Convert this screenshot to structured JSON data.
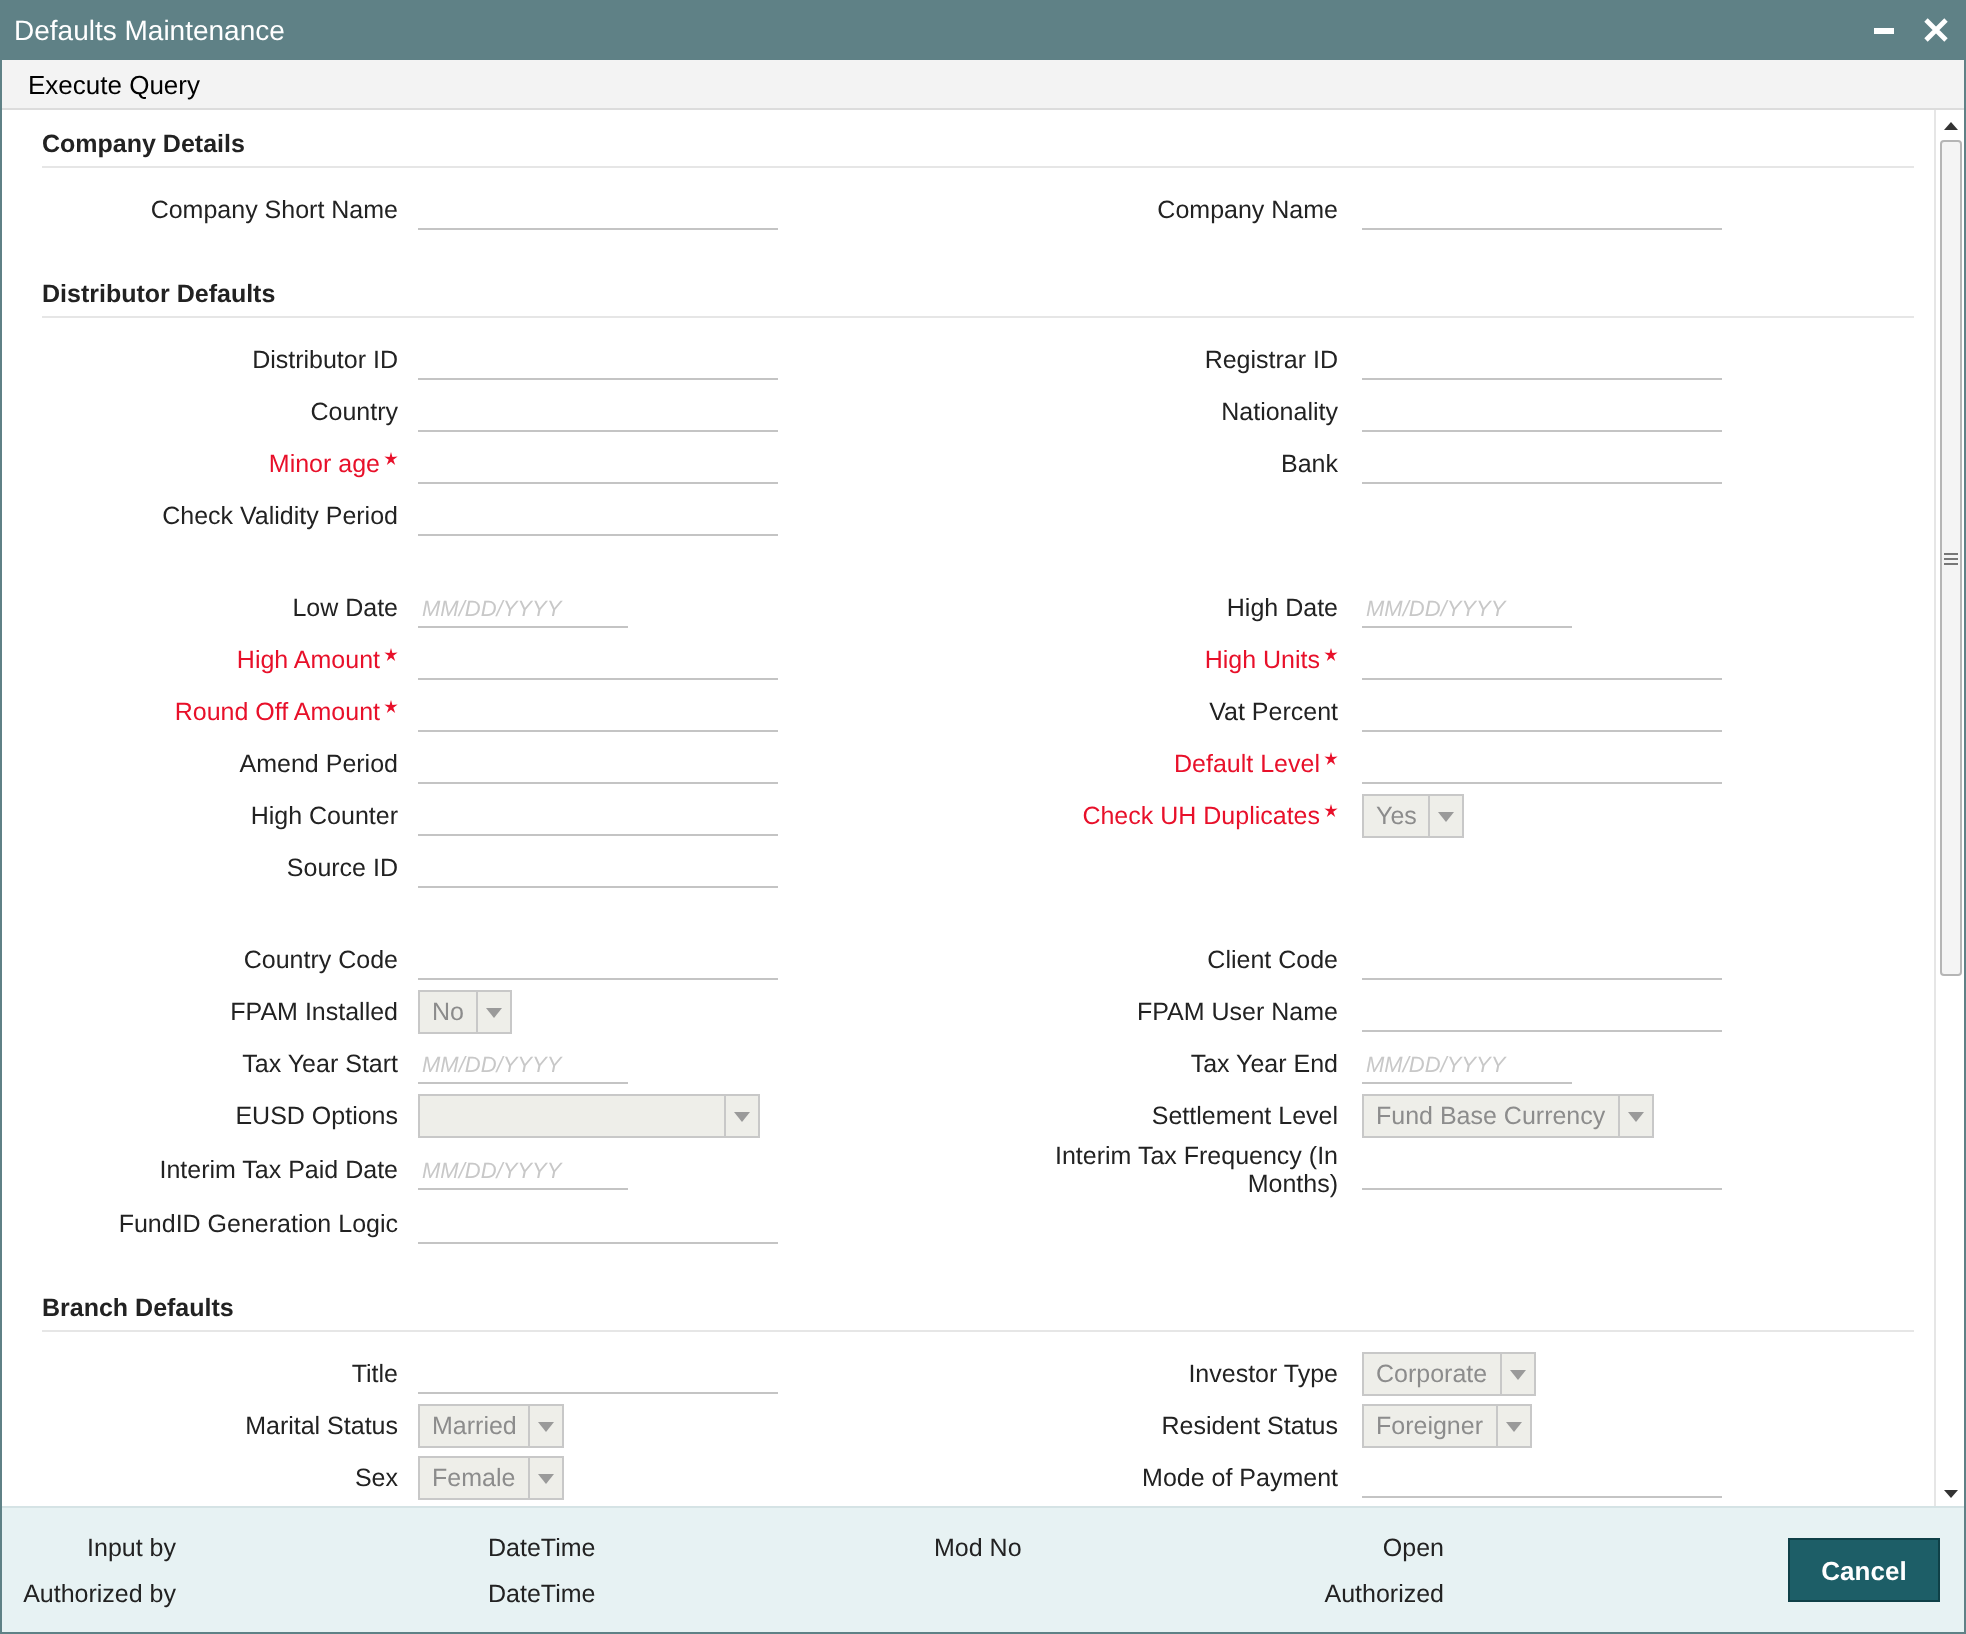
{
  "window": {
    "title": "Defaults Maintenance"
  },
  "menu": [
    {
      "label": "Execute Query"
    }
  ],
  "sections": [
    {
      "title": "Company Details",
      "groups": [
        [
          {
            "left": {
              "label": "Company Short Name",
              "required": false,
              "kind": "text"
            },
            "right": {
              "label": "Company Name",
              "required": false,
              "kind": "text"
            }
          }
        ]
      ]
    },
    {
      "title": "Distributor Defaults",
      "groups": [
        [
          {
            "left": {
              "label": "Distributor ID",
              "required": false,
              "kind": "text"
            },
            "right": {
              "label": "Registrar ID",
              "required": false,
              "kind": "text"
            }
          },
          {
            "left": {
              "label": "Country",
              "required": false,
              "kind": "text"
            },
            "right": {
              "label": "Nationality",
              "required": false,
              "kind": "text"
            }
          },
          {
            "left": {
              "label": "Minor age",
              "required": true,
              "kind": "text"
            },
            "right": {
              "label": "Bank",
              "required": false,
              "kind": "text"
            }
          },
          {
            "left": {
              "label": "Check Validity Period",
              "required": false,
              "kind": "text"
            }
          }
        ],
        [
          {
            "left": {
              "label": "Low Date",
              "required": false,
              "kind": "date",
              "placeholder": "MM/DD/YYYY"
            },
            "right": {
              "label": "High Date",
              "required": false,
              "kind": "date",
              "placeholder": "MM/DD/YYYY"
            }
          },
          {
            "left": {
              "label": "High Amount",
              "required": true,
              "kind": "text"
            },
            "right": {
              "label": "High Units",
              "required": true,
              "kind": "text"
            }
          },
          {
            "left": {
              "label": "Round Off Amount",
              "required": true,
              "kind": "text"
            },
            "right": {
              "label": "Vat Percent",
              "required": false,
              "kind": "text"
            }
          },
          {
            "left": {
              "label": "Amend Period",
              "required": false,
              "kind": "text"
            },
            "right": {
              "label": "Default Level",
              "required": true,
              "kind": "text"
            }
          },
          {
            "left": {
              "label": "High Counter",
              "required": false,
              "kind": "text"
            },
            "right": {
              "label": "Check UH Duplicates",
              "required": true,
              "kind": "select",
              "value": "Yes"
            }
          },
          {
            "left": {
              "label": "Source ID",
              "required": false,
              "kind": "text"
            }
          }
        ],
        [
          {
            "left": {
              "label": "Country Code",
              "required": false,
              "kind": "text"
            },
            "right": {
              "label": "Client Code",
              "required": false,
              "kind": "text"
            }
          },
          {
            "left": {
              "label": "FPAM Installed",
              "required": false,
              "kind": "select",
              "value": "No"
            },
            "right": {
              "label": "FPAM User Name",
              "required": false,
              "kind": "text"
            }
          },
          {
            "left": {
              "label": "Tax Year Start",
              "required": false,
              "kind": "date",
              "placeholder": "MM/DD/YYYY"
            },
            "right": {
              "label": "Tax Year End",
              "required": false,
              "kind": "date",
              "placeholder": "MM/DD/YYYY"
            }
          },
          {
            "left": {
              "label": "EUSD Options",
              "required": false,
              "kind": "select"
            },
            "right": {
              "label": "Settlement Level",
              "required": false,
              "kind": "select",
              "value": "Fund Base Currency"
            }
          },
          {
            "left": {
              "label": "Interim Tax Paid Date",
              "required": false,
              "kind": "date",
              "placeholder": "MM/DD/YYYY"
            },
            "right": {
              "label": "Interim Tax Frequency (In Months)",
              "required": false,
              "kind": "text"
            }
          },
          {
            "left": {
              "label": "FundID Generation Logic",
              "required": false,
              "kind": "text"
            }
          }
        ]
      ]
    },
    {
      "title": "Branch Defaults",
      "groups": [
        [
          {
            "left": {
              "label": "Title",
              "required": false,
              "kind": "text"
            },
            "right": {
              "label": "Investor Type",
              "required": false,
              "kind": "select",
              "value": "Corporate"
            }
          },
          {
            "left": {
              "label": "Marital Status",
              "required": false,
              "kind": "select",
              "value": "Married"
            },
            "right": {
              "label": "Resident Status",
              "required": false,
              "kind": "select",
              "value": "Foreigner"
            }
          },
          {
            "left": {
              "label": "Sex",
              "required": false,
              "kind": "select",
              "value": "Female"
            },
            "right": {
              "label": "Mode of Payment",
              "required": false,
              "kind": "text"
            }
          }
        ]
      ]
    }
  ],
  "footer": {
    "columns": [
      [
        "Input by",
        "Authorized by"
      ],
      [
        "DateTime",
        "DateTime"
      ],
      [
        "Mod No"
      ],
      [
        "Open",
        "Authorized"
      ]
    ]
  },
  "buttons": [
    {
      "label": "Cancel"
    }
  ]
}
